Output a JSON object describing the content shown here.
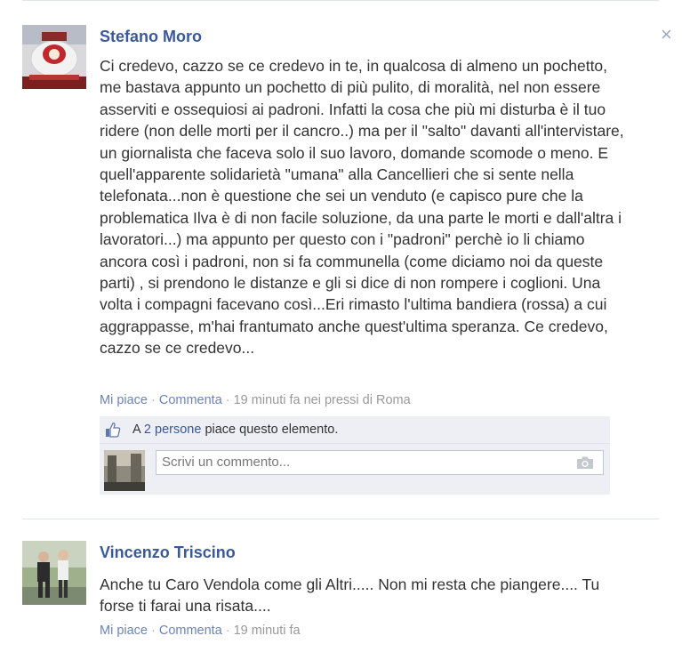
{
  "close_icon": "×",
  "posts": [
    {
      "author": "Stefano Moro",
      "text": "Ci credevo, cazzo se ce credevo in te, in qualcosa di almeno un pochetto, me bastava appunto un pochetto di più pulito, di moralità, nel non essere asserviti e ossequiosi ai padroni. Infatti la cosa che più mi disturba è il tuo ridere (non delle morti per il cancro..) ma per il \"salto\" davanti all'intervistare, un giornalista che faceva solo il suo lavoro, domande scomode o meno. E quell'apparente solidarietà \"umana\" alla Cancellieri che si sente nella telefonata...non è questione che sei un venduto (e capisco pure che la problematica Ilva è di non facile soluzione, da una parte le morti e dall'altra i lavoratori...) ma appunto per questo con i \"padroni\" perchè io li chiamo ancora così i padroni, non si fa communella (come diciamo noi da queste parti) , si prendono le distanze e gli si dice di non rompere i coglioni. Una volta i compagni facevano così...Eri rimasto l'ultima bandiera (rossa) a cui aggrappasse, m'hai frantumato anche quest'ultima speranza. Ce credevo, cazzo se ce credevo...",
      "like_label": "Mi piace",
      "comment_label": "Commenta",
      "time": "19 minuti fa nei pressi di Roma",
      "likes": {
        "prefix": "A",
        "count_link": "2 persone",
        "suffix": "piace questo elemento."
      },
      "comment_placeholder": "Scrivi un commento..."
    },
    {
      "author": "Vincenzo Triscino",
      "text": "Anche tu Caro Vendola come gli Altri..... Non mi resta che piangere.... Tu forse ti farai una risata....",
      "like_label": "Mi piace",
      "comment_label": "Commenta",
      "time": "19 minuti fa"
    }
  ],
  "separator": "·"
}
